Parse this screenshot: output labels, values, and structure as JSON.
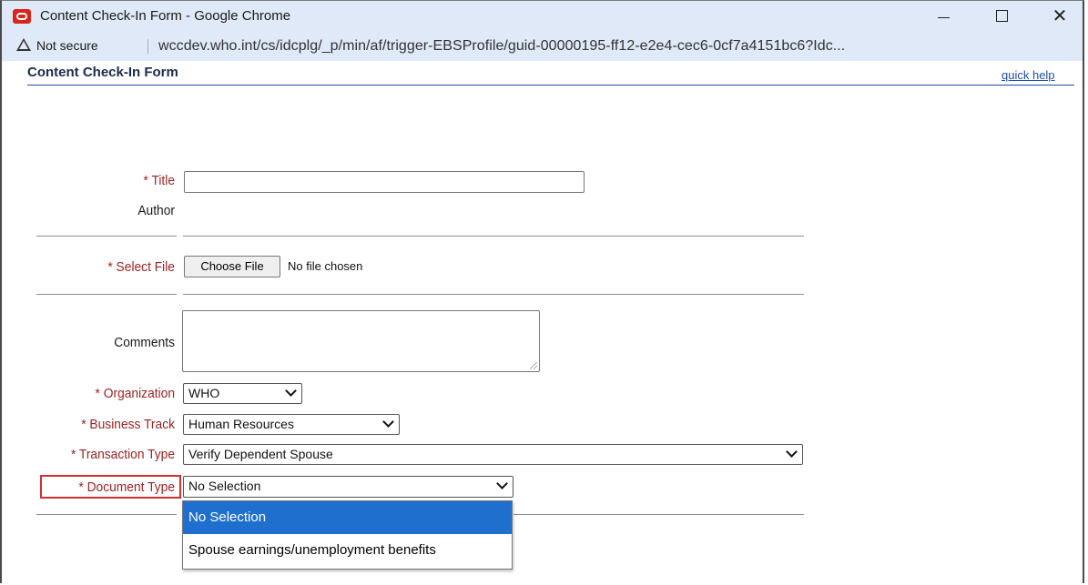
{
  "window": {
    "title": "Content Check-In Form - Google Chrome",
    "minimize_label": "—",
    "close_label": "✕"
  },
  "address_bar": {
    "security_label": "Not secure",
    "url": "wccdev.who.int/cs/idcplg/_p/min/af/trigger-EBSProfile/guid-00000195-ff12-e2e4-cec6-0cf7a4151bc6?Idc..."
  },
  "form": {
    "title": "Content Check-In Form",
    "quick_help": "quick help",
    "fields": {
      "title_label": "* Title",
      "title_value": "",
      "author_label": "Author",
      "select_file_label": "* Select File",
      "choose_file_button": "Choose File",
      "file_status": "No file chosen",
      "comments_label": "Comments",
      "comments_value": "",
      "organization_label": "* Organization",
      "organization_value": "WHO",
      "business_track_label": "* Business Track",
      "business_track_value": "Human Resources",
      "transaction_type_label": "* Transaction Type",
      "transaction_type_value": "Verify Dependent Spouse",
      "document_type_label": "* Document Type",
      "document_type_value": "No Selection"
    },
    "document_type_options": [
      {
        "label": "No Selection",
        "selected": true
      },
      {
        "label": "Spouse earnings/unemployment benefits",
        "selected": false
      }
    ]
  },
  "colors": {
    "required_label": "#9b2323",
    "highlight_box": "#d42f2f",
    "selected_option": "#1f6fce",
    "title_rule": "#1f4e9b"
  }
}
